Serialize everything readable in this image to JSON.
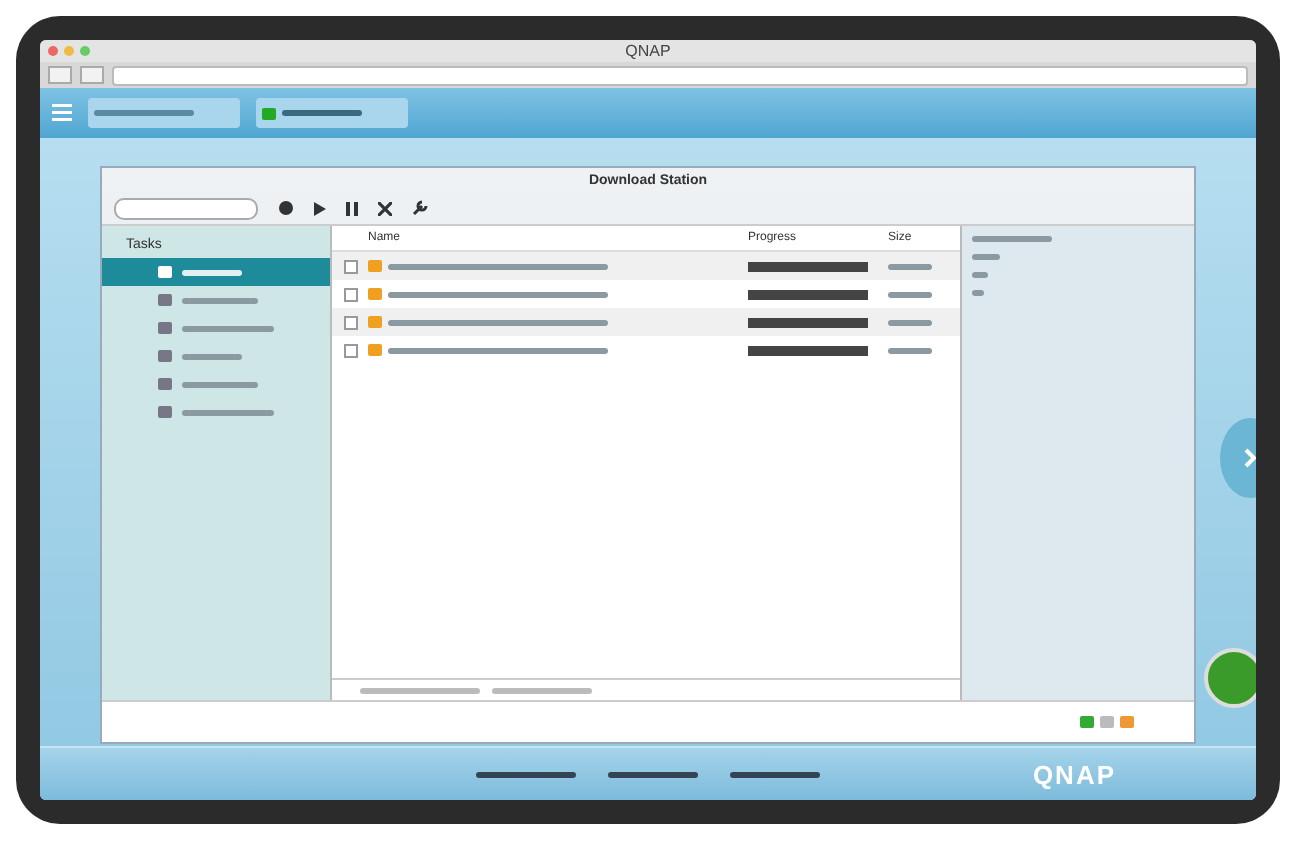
{
  "browser": {
    "title": "QNAP"
  },
  "window": {
    "title": "Download Station"
  },
  "sidebar": {
    "header": "Tasks",
    "items": [
      {
        "selected": true
      },
      {
        "selected": false
      },
      {
        "selected": false
      },
      {
        "selected": false
      },
      {
        "selected": false
      },
      {
        "selected": false
      }
    ]
  },
  "table": {
    "columns": [
      "Name",
      "Progress",
      "Size"
    ],
    "rows": [
      {
        "checked": false,
        "level": 1
      },
      {
        "checked": false,
        "level": 1
      },
      {
        "checked": false,
        "level": 1
      },
      {
        "checked": false,
        "level": 1
      }
    ]
  },
  "logo": "QNAP"
}
